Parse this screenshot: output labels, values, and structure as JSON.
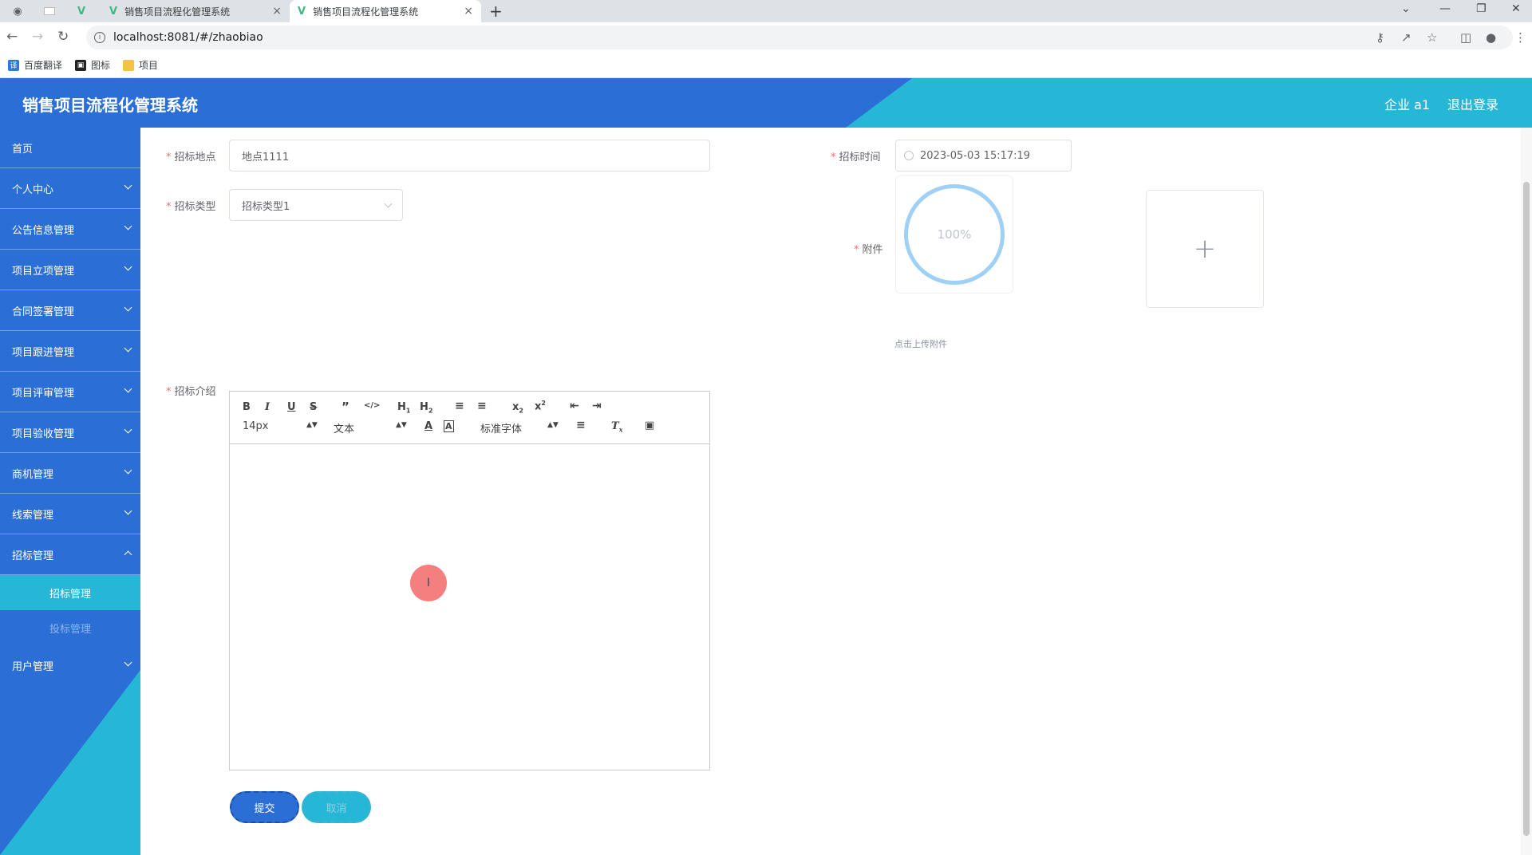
{
  "browser": {
    "tabs": [
      {
        "title": "销售项目流程化管理系统",
        "active": false
      },
      {
        "title": "销售项目流程化管理系统",
        "active": true
      }
    ],
    "new_tab": "+",
    "close": "×",
    "url": "localhost:8081/#/zhaobiao",
    "bookmarks": [
      {
        "label": "百度翻译",
        "icon": "translate-icon"
      },
      {
        "label": "图标",
        "icon": "image-icon"
      },
      {
        "label": "项目",
        "icon": "folder-icon"
      }
    ]
  },
  "header": {
    "title": "销售项目流程化管理系统",
    "user": "企业 a1",
    "logout": "退出登录"
  },
  "sidebar": {
    "items": [
      {
        "label": "首页"
      },
      {
        "label": "个人中心"
      },
      {
        "label": "公告信息管理"
      },
      {
        "label": "项目立项管理"
      },
      {
        "label": "合同签署管理"
      },
      {
        "label": "项目跟进管理"
      },
      {
        "label": "项目评审管理"
      },
      {
        "label": "项目验收管理"
      },
      {
        "label": "商机管理"
      },
      {
        "label": "线索管理"
      },
      {
        "label": "招标管理"
      }
    ],
    "submenu": [
      {
        "label": "招标管理",
        "active": true
      },
      {
        "label": "投标管理",
        "active": false
      }
    ],
    "last": {
      "label": "用户管理"
    }
  },
  "form": {
    "location_label": "招标地点",
    "location_value": "地点1111",
    "type_label": "招标类型",
    "type_value": "招标类型1",
    "time_label": "招标时间",
    "time_value": "2023-05-03 15:17:19",
    "attachment_label": "附件",
    "upload_progress": "100%",
    "upload_plus": "+",
    "upload_tip": "点击上传附件",
    "intro_label": "招标介绍",
    "required_mark": "*"
  },
  "editor": {
    "font_size": "14px",
    "block": "文本",
    "font_family": "标准字体",
    "buttons": [
      "bold-icon",
      "italic-icon",
      "underline-icon",
      "strike-icon",
      "quote-icon",
      "code-icon",
      "h1-icon",
      "h2-icon",
      "ordered-list-icon",
      "bullet-list-icon",
      "subscript-icon",
      "superscript-icon",
      "outdent-icon",
      "indent-icon",
      "font-color-icon",
      "background-color-icon",
      "align-icon",
      "clear-format-icon",
      "image-icon"
    ]
  },
  "actions": {
    "submit": "提交",
    "cancel": "取消"
  },
  "colors": {
    "primary": "#2b6fd6",
    "accent": "#26b6d6",
    "required": "#f56c6c"
  }
}
